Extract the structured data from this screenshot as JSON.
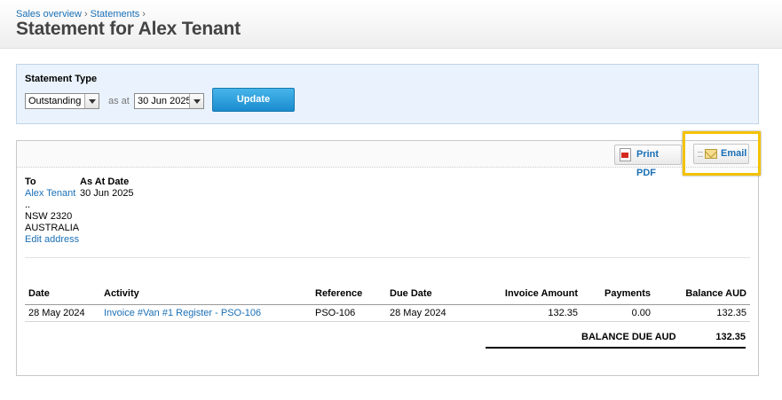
{
  "breadcrumb": {
    "item1": "Sales overview",
    "item2": "Statements",
    "separator": "›"
  },
  "page_title": "Statement for Alex Tenant",
  "filters": {
    "statement_type_label": "Statement Type",
    "statement_type_value": "Outstanding",
    "as_at_label": "as at",
    "date_value": "30 Jun 2025",
    "update_label": "Update"
  },
  "toolbar": {
    "print_pdf_label": "Print PDF",
    "email_label": "Email"
  },
  "recipient": {
    "to_label": "To",
    "name": "Alex Tenant",
    "line1": "..",
    "line2": "NSW 2320",
    "line3": "AUSTRALIA",
    "edit_address": "Edit address"
  },
  "as_at": {
    "label": "As At Date",
    "value": "30 Jun 2025"
  },
  "table": {
    "headers": [
      "Date",
      "Activity",
      "Reference",
      "Due Date",
      "Invoice Amount",
      "Payments",
      "Balance AUD"
    ],
    "rows": [
      {
        "date": "28 May 2024",
        "activity": "Invoice #Van #1 Register - PSO-106",
        "reference": "PSO-106",
        "due_date": "28 May 2024",
        "invoice_amount": "132.35",
        "payments": "0.00",
        "balance": "132.35"
      }
    ]
  },
  "balance_due": {
    "label": "BALANCE DUE AUD",
    "value": "132.35"
  },
  "colors": {
    "accent": "#1a6fb5",
    "update_button": "#2a9ad8",
    "highlight": "#f2c200"
  }
}
